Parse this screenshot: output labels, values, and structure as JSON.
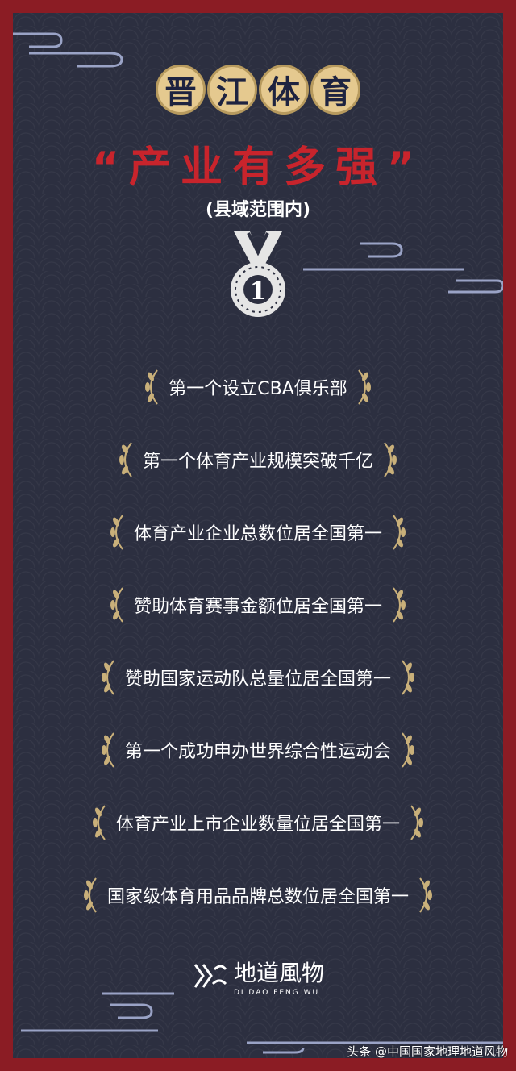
{
  "header": {
    "title_chars": [
      "晋",
      "江",
      "体",
      "育"
    ],
    "subtitle": "“产业有多强”",
    "scope": "(县域范围内)"
  },
  "medal": {
    "number": "1"
  },
  "items": [
    {
      "label": "第一个设立CBA俱乐部"
    },
    {
      "label": "第一个体育产业规模突破千亿"
    },
    {
      "label": "体育产业企业总数位居全国第一"
    },
    {
      "label": "赞助体育赛事金额位居全国第一"
    },
    {
      "label": "赞助国家运动队总量位居全国第一"
    },
    {
      "label": "第一个成功申办世界综合性运动会"
    },
    {
      "label": "体育产业上市企业数量位居全国第一"
    },
    {
      "label": "国家级体育用品品牌总数位居全国第一"
    }
  ],
  "logo": {
    "name": "地道風物",
    "pinyin": "DI DAO FENG WU"
  },
  "watermark": "头条 @中国国家地理地道风物",
  "colors": {
    "frame": "#8b1c24",
    "panel": "#2c2f40",
    "gold": "#e5c98f",
    "accent_red": "#c8242c"
  }
}
